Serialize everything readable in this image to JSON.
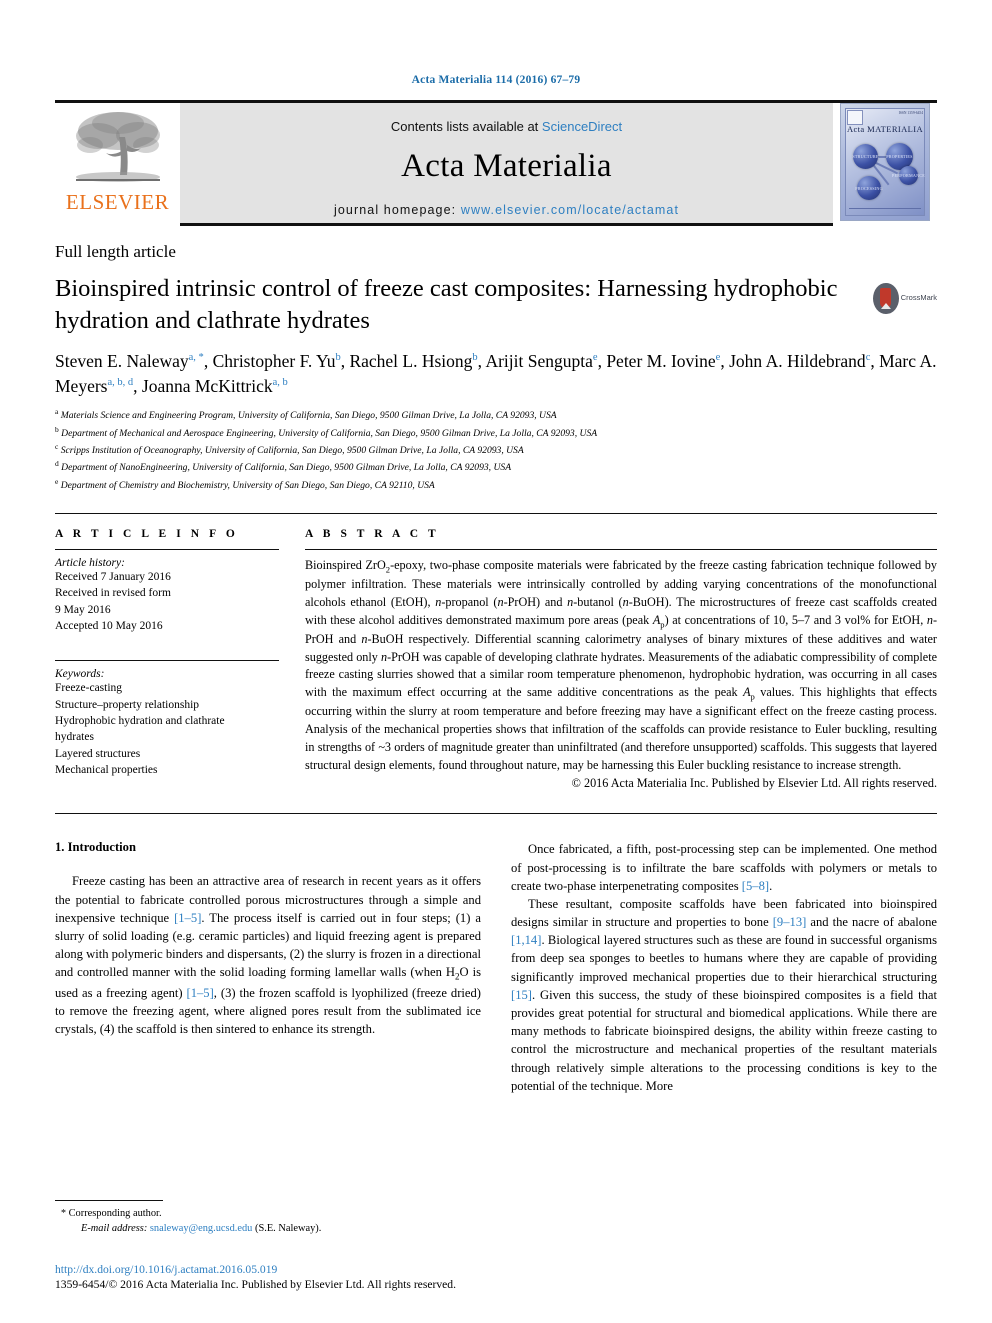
{
  "running_head": "Acta Materialia 114 (2016) 67–79",
  "masthead": {
    "publisher_logo_text": "ELSEVIER",
    "contents_prefix": "Contents lists available at",
    "contents_link": "ScienceDirect",
    "journal_title": "Acta Materialia",
    "homepage_label": "journal homepage:",
    "homepage_url": "www.elsevier.com/locate/actamat",
    "cover": {
      "title": "Acta MATERIALIA",
      "nodes": [
        "STRUCTURE",
        "PROPERTIES",
        "PERFORMANCE",
        "PROCESSING"
      ]
    }
  },
  "article": {
    "type": "Full length article",
    "title": "Bioinspired intrinsic control of freeze cast composites: Harnessing hydrophobic hydration and clathrate hydrates",
    "crossmark_label": "CrossMark",
    "authors_line_1": "Steven E. Naleway",
    "authors": [
      {
        "name": "Steven E. Naleway",
        "marks": "a, *"
      },
      {
        "name": "Christopher F. Yu",
        "marks": "b"
      },
      {
        "name": "Rachel L. Hsiong",
        "marks": "b"
      },
      {
        "name": "Arijit Sengupta",
        "marks": "e"
      },
      {
        "name": "Peter M. Iovine",
        "marks": "e"
      },
      {
        "name": "John A. Hildebrand",
        "marks": "c"
      },
      {
        "name": "Marc A. Meyers",
        "marks": "a, b, d"
      },
      {
        "name": "Joanna McKittrick",
        "marks": "a, b"
      }
    ],
    "affiliations": [
      {
        "mark": "a",
        "text": "Materials Science and Engineering Program, University of California, San Diego, 9500 Gilman Drive, La Jolla, CA 92093, USA"
      },
      {
        "mark": "b",
        "text": "Department of Mechanical and Aerospace Engineering, University of California, San Diego, 9500 Gilman Drive, La Jolla, CA 92093, USA"
      },
      {
        "mark": "c",
        "text": "Scripps Institution of Oceanography, University of California, San Diego, 9500 Gilman Drive, La Jolla, CA 92093, USA"
      },
      {
        "mark": "d",
        "text": "Department of NanoEngineering, University of California, San Diego, 9500 Gilman Drive, La Jolla, CA 92093, USA"
      },
      {
        "mark": "e",
        "text": "Department of Chemistry and Biochemistry, University of San Diego, San Diego, CA 92110, USA"
      }
    ]
  },
  "article_info": {
    "heading": "A R T I C L E   I N F O",
    "history_label": "Article history:",
    "history": [
      "Received 7 January 2016",
      "Received in revised form",
      "9 May 2016",
      "Accepted 10 May 2016"
    ],
    "keywords_label": "Keywords:",
    "keywords": [
      "Freeze-casting",
      "Structure–property relationship",
      "Hydrophobic hydration and clathrate",
      "hydrates",
      "Layered structures",
      "Mechanical properties"
    ]
  },
  "abstract": {
    "heading": "A B S T R A C T",
    "copyright": "© 2016 Acta Materialia Inc. Published by Elsevier Ltd. All rights reserved."
  },
  "introduction": {
    "heading": "1. Introduction",
    "left_paragraph": "Freeze casting has been an attractive area of research in recent years as it offers the potential to fabricate controlled porous microstructures through a simple and inexpensive technique [1–5]. The process itself is carried out in four steps; (1) a slurry of solid loading (e.g. ceramic particles) and liquid freezing agent is prepared along with polymeric binders and dispersants, (2) the slurry is frozen in a directional and controlled manner with the solid loading forming lamellar walls (when H2O is used as a freezing agent) [1–5], (3) the frozen scaffold is lyophilized (freeze dried) to remove the freezing agent, where aligned pores result from the sublimated ice crystals, (4) the scaffold is then sintered to enhance its strength.",
    "right_paragraph_1": "Once fabricated, a fifth, post-processing step can be implemented. One method of post-processing is to infiltrate the bare scaffolds with polymers or metals to create two-phase interpenetrating composites [5–8].",
    "right_paragraph_2": "These resultant, composite scaffolds have been fabricated into bioinspired designs similar in structure and properties to bone [9–13] and the nacre of abalone [1,14]. Biological layered structures such as these are found in successful organisms from deep sea sponges to beetles to humans where they are capable of providing significantly improved mechanical properties due to their hierarchical structuring [15]. Given this success, the study of these bioinspired composites is a field that provides great potential for structural and biomedical applications. While there are many methods to fabricate bioinspired designs, the ability within freeze casting to control the microstructure and mechanical properties of the resultant materials through relatively simple alterations to the processing conditions is key to the potential of the technique. More"
  },
  "footnote": {
    "corresponding_marker": "*",
    "corresponding_label": "Corresponding author.",
    "email_label": "E-mail address:",
    "email": "snaleway@eng.ucsd.edu",
    "email_owner": "(S.E. Naleway)."
  },
  "footer": {
    "doi": "http://dx.doi.org/10.1016/j.actamat.2016.05.019",
    "issn_line": "1359-6454/© 2016 Acta Materialia Inc. Published by Elsevier Ltd. All rights reserved."
  },
  "colors": {
    "link": "#2E7FC1",
    "elsevier_orange": "#E9711C",
    "masthead_bg": "#e3e3e3"
  }
}
